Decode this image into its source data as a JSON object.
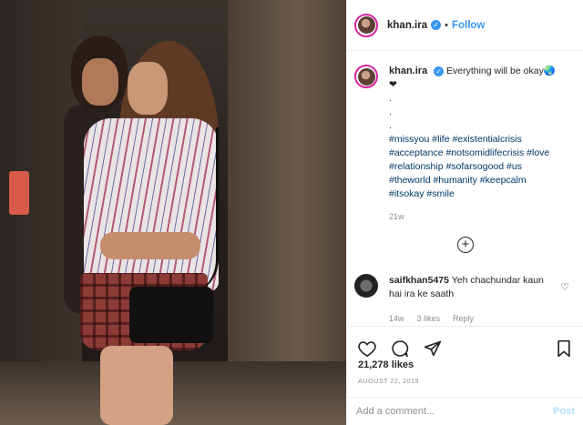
{
  "post": {
    "image_alt": "",
    "username": "khan.ira",
    "follow_label": "Follow",
    "separator": "•"
  },
  "caption": {
    "username": "khan.ira",
    "text": "Everything will be okay🌏 ❤",
    "dots": [
      ".",
      ".",
      "."
    ],
    "hashtags": "#missyou #life #existentialcrisis #acceptance #notsomidlifecrisis #love #relationship #sofarsogood #us #theworld #humanity #keepcalm #itsokay #smile",
    "time": "21w"
  },
  "comments": [
    {
      "username": "saifkhan5475",
      "text": "Yeh chachundar kaun hai ira ke saath",
      "time": "14w",
      "likes": "3 likes",
      "reply": "Reply"
    }
  ],
  "stats": {
    "likes": "21,278 likes",
    "date": "AUGUST 22, 2019"
  },
  "comment_input": {
    "placeholder": "Add a comment...",
    "post_label": "Post"
  },
  "colors": {
    "accent": "#3897f0",
    "hashtag": "#003569",
    "muted": "#8e8e8e",
    "post_disabled": "#b2dffc"
  },
  "icons": {
    "verified": "verified-badge-icon",
    "like": "heart-icon",
    "comment": "comment-icon",
    "share": "share-icon",
    "save": "bookmark-icon",
    "load_more": "plus-circle-icon"
  }
}
